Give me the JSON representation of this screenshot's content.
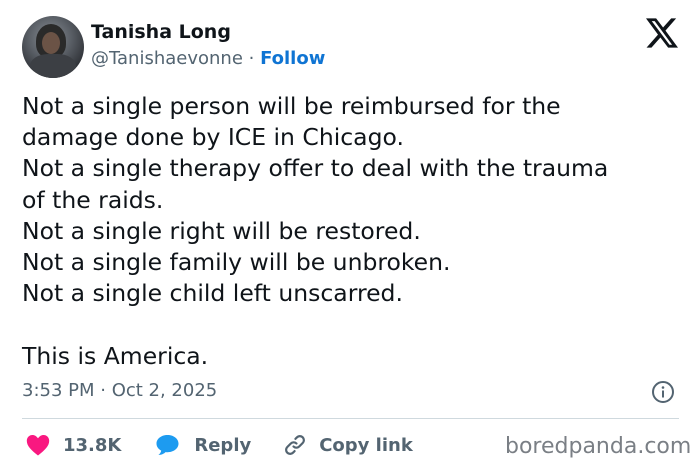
{
  "author": {
    "name": "Tanisha Long",
    "handle": "@Tanishaevonne",
    "separator": " · ",
    "follow_label": "Follow"
  },
  "tweet": {
    "lines": [
      "Not a single person will be reimbursed for the",
      "damage done by ICE in Chicago.",
      "Not a single therapy offer to deal with the trauma",
      "of the raids.",
      "Not a single right will be restored.",
      "Not a single family will be unbroken.",
      "Not a single child left unscarred.",
      "",
      "This is America."
    ]
  },
  "timestamp": "3:53 PM · Oct 2, 2025",
  "actions": {
    "like_count": "13.8K",
    "reply_label": "Reply",
    "copy_link_label": "Copy link"
  },
  "watermark": "boredpanda.com",
  "icons": {
    "like": "heart-icon",
    "reply": "speech-bubble-icon",
    "copy": "link-icon",
    "info": "info-icon",
    "brand": "x-logo-icon"
  },
  "colors": {
    "text": "#0f1419",
    "secondary": "#536471",
    "follow": "#0f74d3",
    "heart": "#f91880",
    "reply_bubble": "#1d9bf0",
    "divider": "#cfd9de"
  }
}
